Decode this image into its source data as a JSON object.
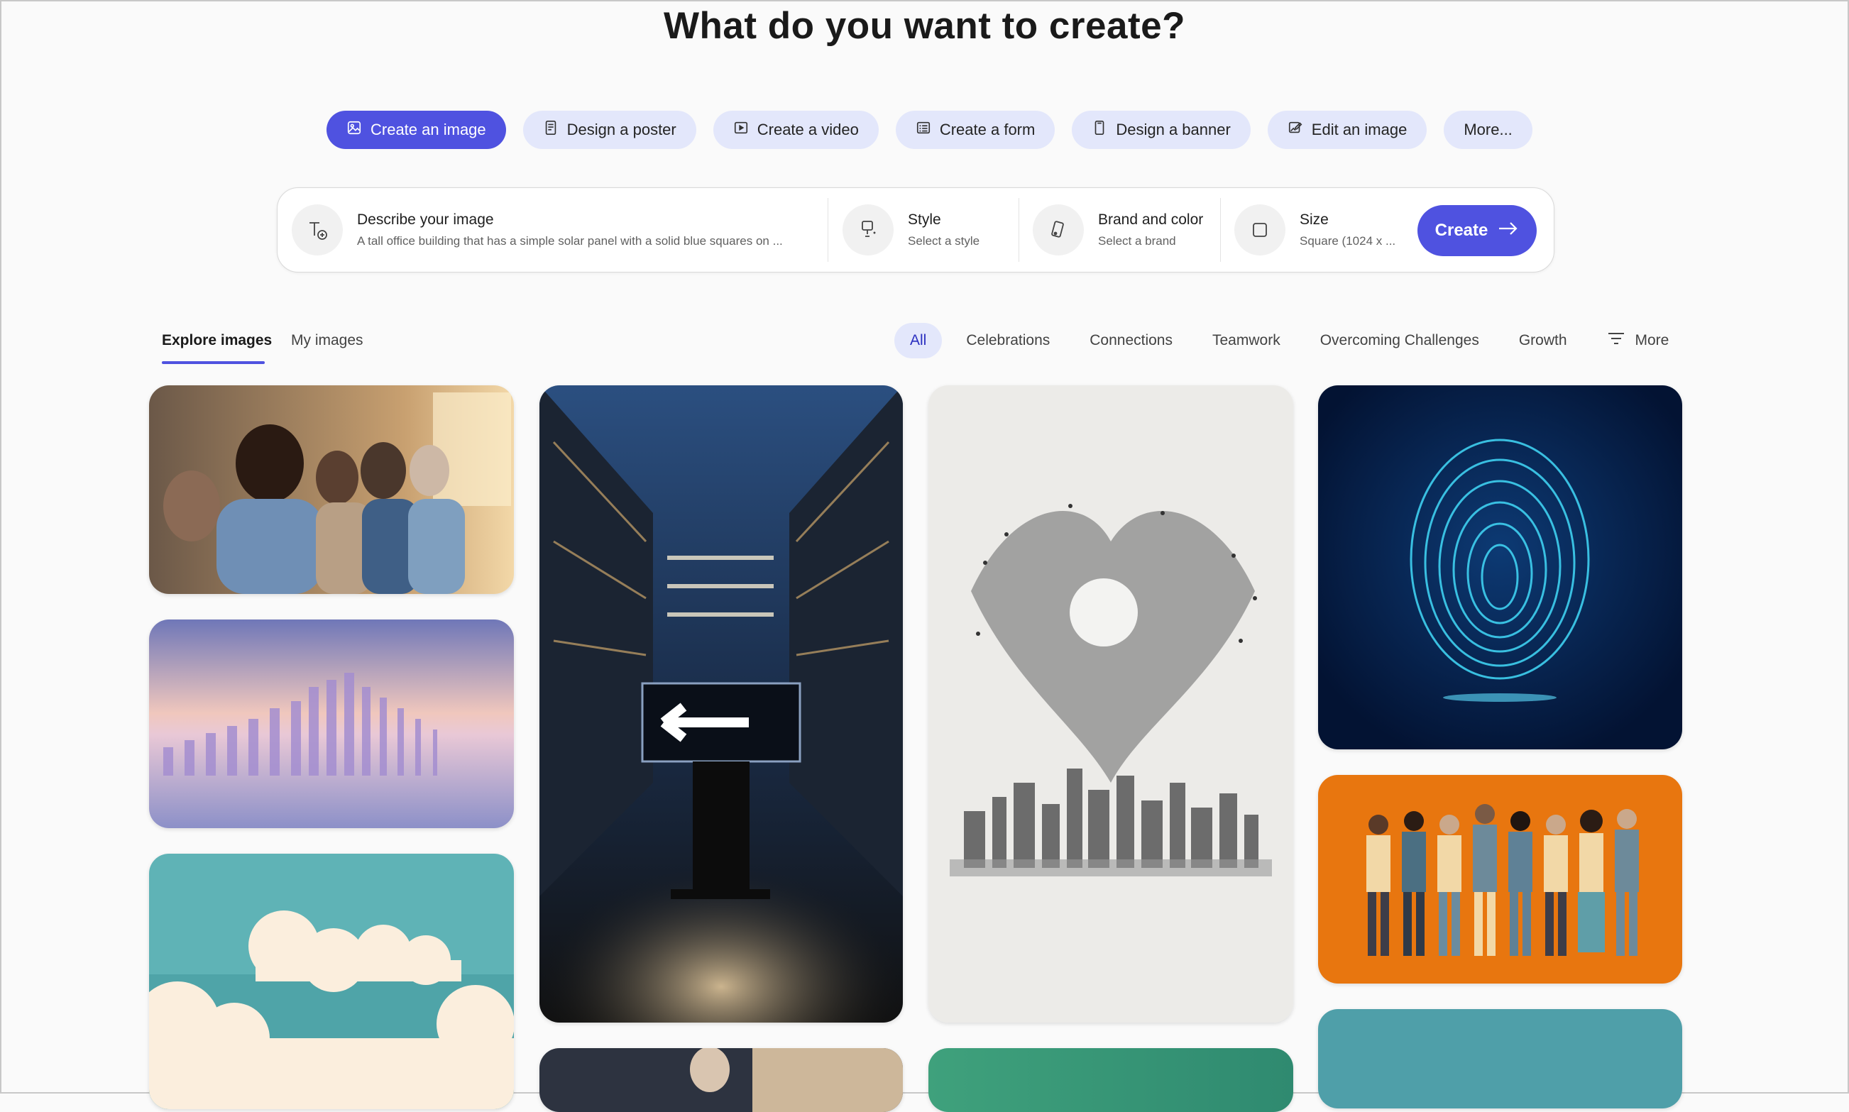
{
  "page": {
    "title": "What do you want to create?"
  },
  "tabs": [
    {
      "label": "Create an image",
      "icon": "image-icon",
      "active": true
    },
    {
      "label": "Design a poster",
      "icon": "poster-icon",
      "active": false
    },
    {
      "label": "Create a video",
      "icon": "video-icon",
      "active": false
    },
    {
      "label": "Create a form",
      "icon": "form-icon",
      "active": false
    },
    {
      "label": "Design a banner",
      "icon": "banner-icon",
      "active": false
    },
    {
      "label": "Edit an image",
      "icon": "edit-image-icon",
      "active": false
    },
    {
      "label": "More...",
      "icon": "",
      "active": false
    }
  ],
  "prompt": {
    "describe": {
      "label": "Describe your image",
      "value": "A tall office building that has a simple solar panel with a solid blue squares on ..."
    },
    "style": {
      "label": "Style",
      "value": "Select a style"
    },
    "brand": {
      "label": "Brand and color",
      "value": "Select a brand"
    },
    "size": {
      "label": "Size",
      "value": "Square (1024 x ..."
    },
    "create_label": "Create"
  },
  "explore": {
    "tabs": [
      "Explore images",
      "My images"
    ],
    "filters": [
      "All",
      "Celebrations",
      "Connections",
      "Teamwork",
      "Overcoming Challenges",
      "Growth"
    ],
    "more_label": "More"
  },
  "gallery": [
    {
      "subject": "audience-applauding"
    },
    {
      "subject": "glass-bars-reflection"
    },
    {
      "subject": "clouds-teal-sky"
    },
    {
      "subject": "office-atrium-arrow-sign"
    },
    {
      "subject": "person-at-desk"
    },
    {
      "subject": "birds-forming-heart-over-city"
    },
    {
      "subject": "green-texture"
    },
    {
      "subject": "glowing-fingerprint"
    },
    {
      "subject": "diverse-people-orange"
    },
    {
      "subject": "teal-abstract"
    }
  ],
  "colors": {
    "accent": "#4f52e0",
    "pill_bg": "#e3e7fb",
    "page_bg": "#fafafa"
  }
}
